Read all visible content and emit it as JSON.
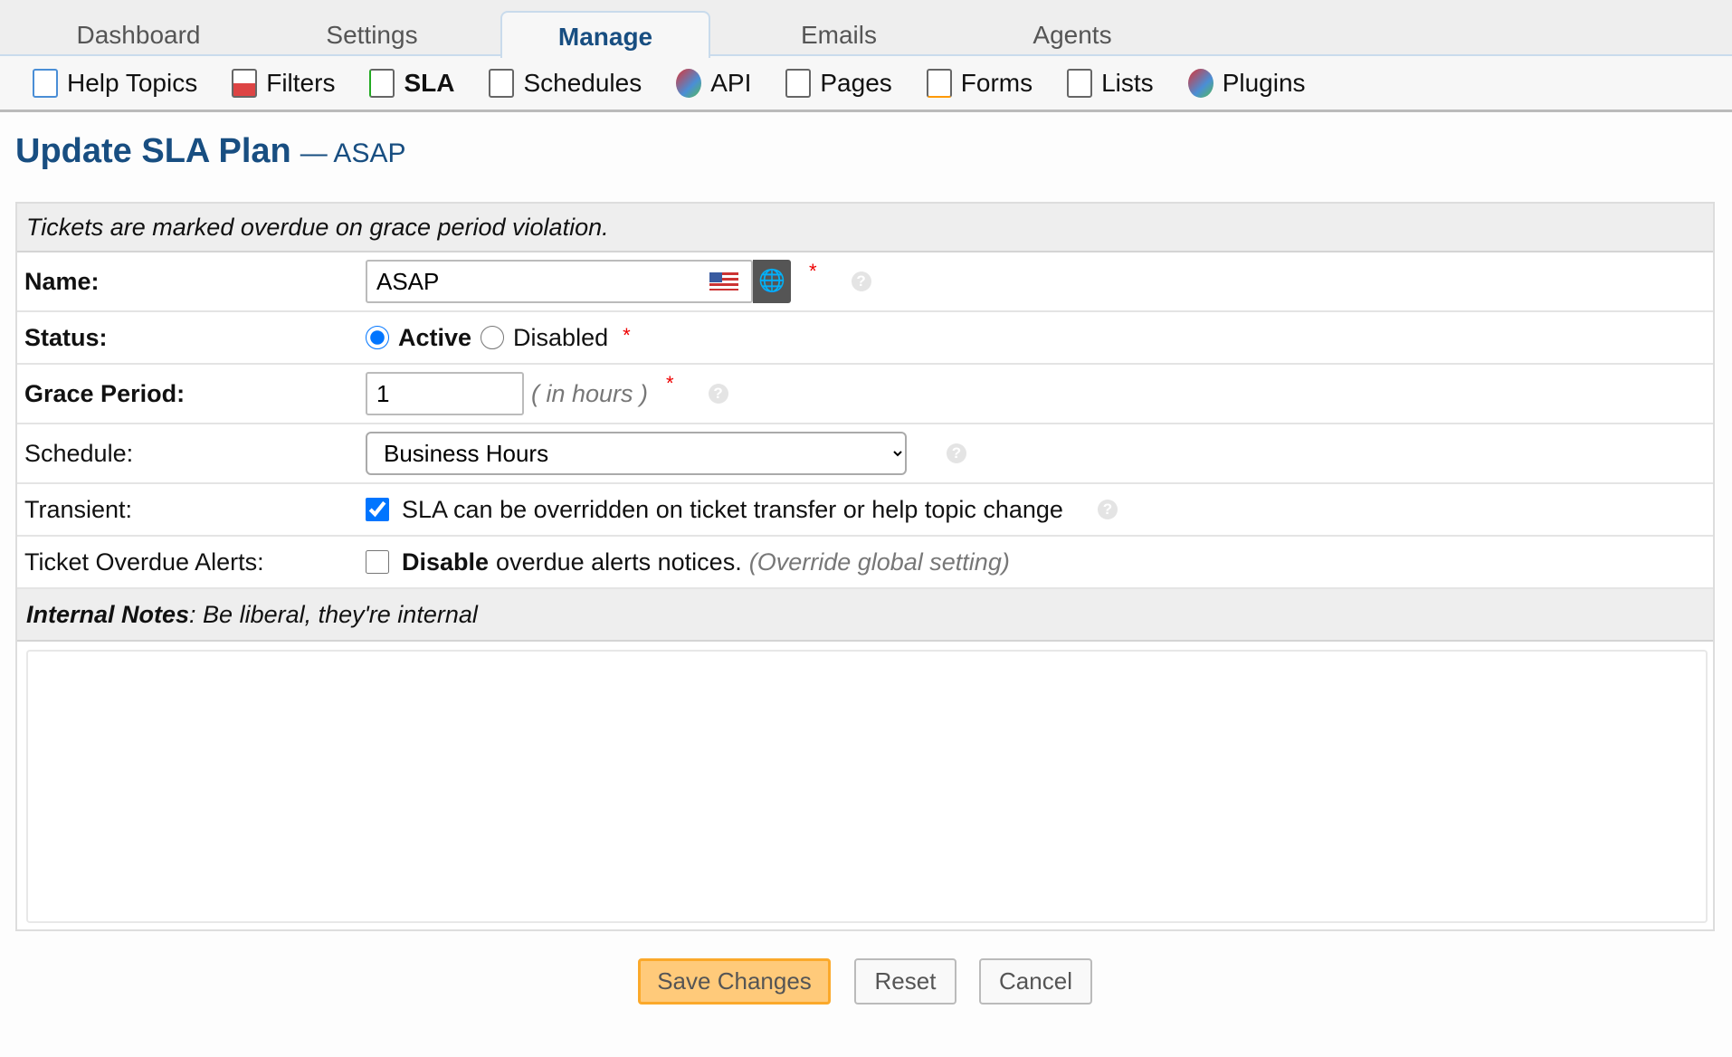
{
  "tabs": [
    {
      "label": "Dashboard"
    },
    {
      "label": "Settings"
    },
    {
      "label": "Manage",
      "active": true
    },
    {
      "label": "Emails"
    },
    {
      "label": "Agents"
    }
  ],
  "subnav": [
    {
      "label": "Help Topics",
      "icon": "help-topics-icon"
    },
    {
      "label": "Filters",
      "icon": "filters-icon"
    },
    {
      "label": "SLA",
      "icon": "sla-icon",
      "active": true
    },
    {
      "label": "Schedules",
      "icon": "schedules-icon"
    },
    {
      "label": "API",
      "icon": "api-icon"
    },
    {
      "label": "Pages",
      "icon": "pages-icon"
    },
    {
      "label": "Forms",
      "icon": "forms-icon"
    },
    {
      "label": "Lists",
      "icon": "lists-icon"
    },
    {
      "label": "Plugins",
      "icon": "plugins-icon"
    }
  ],
  "page": {
    "title": "Update SLA Plan",
    "subtitle": "— ASAP"
  },
  "form": {
    "notice": "Tickets are marked overdue on grace period violation.",
    "name": {
      "label": "Name:",
      "value": "ASAP"
    },
    "status": {
      "label": "Status:",
      "active": "Active",
      "disabled": "Disabled",
      "selected": "Active"
    },
    "grace": {
      "label": "Grace Period:",
      "value": "1",
      "unit": "( in hours )"
    },
    "schedule": {
      "label": "Schedule:",
      "value": "Business Hours"
    },
    "transient": {
      "label": "Transient:",
      "text": "SLA can be overridden on ticket transfer or help topic change",
      "checked": true
    },
    "alerts": {
      "label": "Ticket Overdue Alerts:",
      "bold": "Disable",
      "text": "overdue alerts notices.",
      "note": "(Override global setting)",
      "checked": false
    },
    "notes": {
      "bold": "Internal Notes",
      "text": ": Be liberal, they're internal",
      "value": ""
    },
    "required": "*",
    "help": "?"
  },
  "buttons": {
    "save": "Save Changes",
    "reset": "Reset",
    "cancel": "Cancel"
  },
  "colors": {
    "accent": "#184e81",
    "save": "#ffca7a",
    "checkbox": "#1a73e8"
  }
}
